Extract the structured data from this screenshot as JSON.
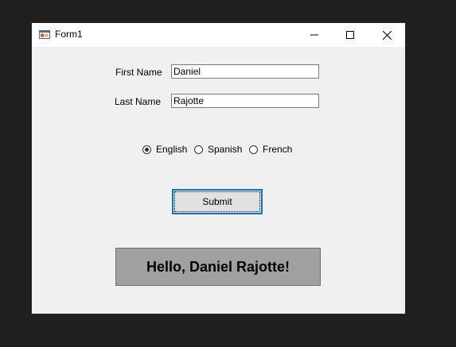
{
  "window": {
    "title": "Form1"
  },
  "form": {
    "first_name_label": "First Name",
    "first_name_value": "Daniel",
    "last_name_label": "Last Name",
    "last_name_value": "Rajotte",
    "languages": [
      {
        "label": "English",
        "checked": true
      },
      {
        "label": "Spanish",
        "checked": false
      },
      {
        "label": "French",
        "checked": false
      }
    ],
    "submit_label": "Submit",
    "greeting": "Hello, Daniel Rajotte!"
  },
  "icons": {
    "app": "form-app-icon",
    "minimize": "minimize-icon",
    "maximize": "maximize-icon",
    "close": "close-icon"
  },
  "colors": {
    "window_bg": "#f0f0f0",
    "titlebar_bg": "#ffffff",
    "desktop_bg": "#1f1f1f",
    "focus_border": "#0078d7",
    "greeting_bg": "#a0a0a0"
  }
}
